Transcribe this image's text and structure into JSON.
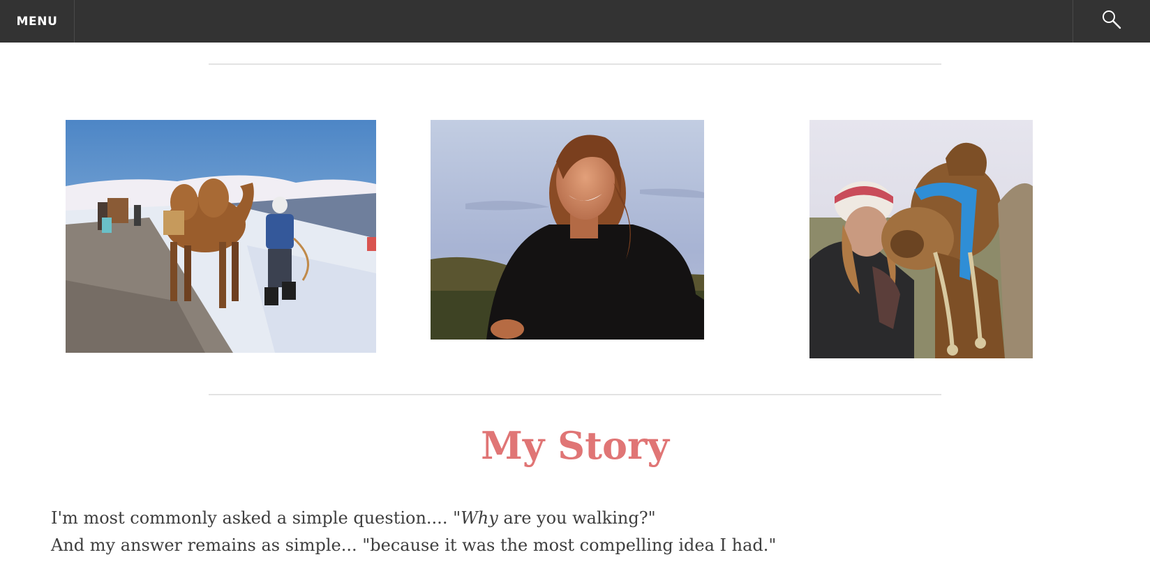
{
  "nav": {
    "menu_label": "MENU",
    "search_icon": "magnifier-icon"
  },
  "gallery": {
    "photos": [
      {
        "icon": "photo-camel-caravan-snow"
      },
      {
        "icon": "photo-woman-portrait-sunset"
      },
      {
        "icon": "photo-woman-with-camel"
      }
    ]
  },
  "story": {
    "title": "My Story",
    "line1_pre": "I'm most commonly asked a simple question.... \"",
    "line1_em": "Why",
    "line1_post": " are you walking?\"",
    "line2": "And my answer remains as simple... \"because it was the most compelling idea I had.\""
  },
  "colors": {
    "topbar": "#333333",
    "title_accent": "#e07575",
    "body_text": "#3e3e3e",
    "rule": "#e3e3e3"
  }
}
